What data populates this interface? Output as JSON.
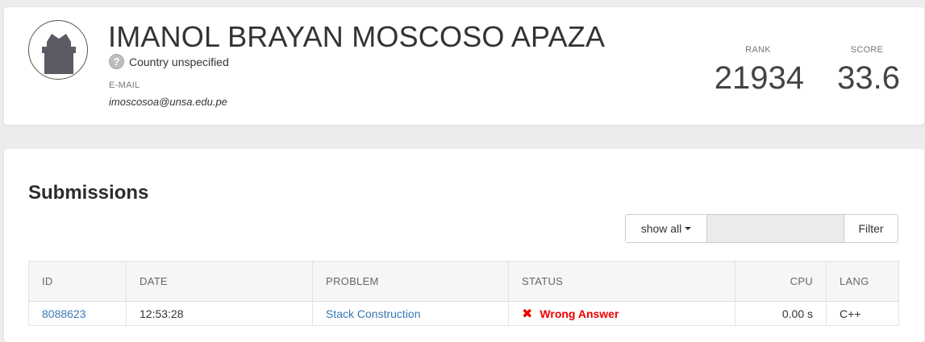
{
  "profile": {
    "name": "IMANOL BRAYAN MOSCOSO APAZA",
    "country": "Country unspecified",
    "email_label": "E-MAIL",
    "email": "imoscosoa@unsa.edu.pe",
    "rank_label": "RANK",
    "rank": "21934",
    "score_label": "SCORE",
    "score": "33.6",
    "avatar_icon": "default-avatar-icon",
    "country_icon": "question-icon"
  },
  "submissions": {
    "title": "Submissions",
    "show_all_label": "show all",
    "filter_placeholder": "",
    "filter_label": "Filter",
    "columns": [
      "ID",
      "DATE",
      "PROBLEM",
      "STATUS",
      "CPU",
      "LANG"
    ],
    "rows": [
      {
        "id": "8088623",
        "date": "12:53:28",
        "problem": "Stack Construction",
        "status": "Wrong Answer",
        "status_icon": "x-icon",
        "cpu": "0.00 s",
        "lang": "C++"
      }
    ]
  },
  "colors": {
    "link": "#3a77b5",
    "wrong": "#e00000",
    "background": "#ececec"
  }
}
